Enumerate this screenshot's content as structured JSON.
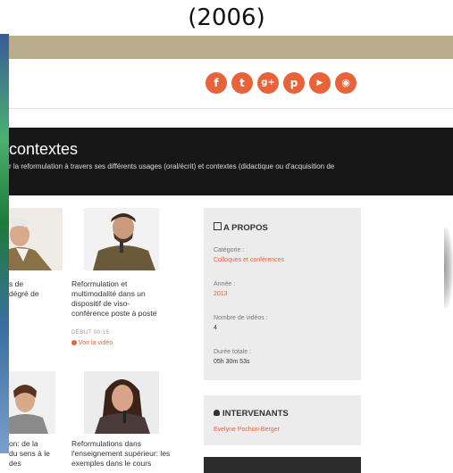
{
  "caption": "(2006)",
  "social": {
    "items": [
      {
        "icon": "facebook-icon",
        "glyph": "f"
      },
      {
        "icon": "twitter-icon",
        "glyph": "t"
      },
      {
        "icon": "google-plus-icon",
        "glyph": "g+"
      },
      {
        "icon": "pinterest-icon",
        "glyph": "p"
      },
      {
        "icon": "youtube-icon",
        "glyph": "▶"
      },
      {
        "icon": "rss-icon",
        "glyph": "◉"
      }
    ],
    "color": "#e8623a"
  },
  "header": {
    "title": "contextes",
    "subtitle": "r la reformulation à travers ses différents usages (oral/écrit) et contextes (didactique ou d'acquisition de"
  },
  "cards": [
    {
      "title_lines": [
        "s de",
        "dégré de"
      ]
    },
    {
      "title_lines": [
        "Reformulation et",
        "multimodalité dans un",
        "dispositif de viso-",
        "conférence poste à poste"
      ],
      "meta": "DÉBUT 00:15",
      "see": "Voir la vidéo"
    },
    {
      "title_lines": [
        "on: de la",
        "du sens à le",
        "des"
      ]
    },
    {
      "title_lines": [
        "Reformulations dans",
        "l'enseignement supérieur: les",
        "exemples dans le cours"
      ]
    }
  ],
  "about": {
    "heading": "A PROPOS",
    "category_label": "Catégorie :",
    "category_value": "Colloques et conférences",
    "year_label": "Année :",
    "year_value": "2013",
    "videos_label": "Nombre de vidéos :",
    "videos_value": "4",
    "duration_label": "Durée totale :",
    "duration_value": "05h 30m 53s"
  },
  "speakers": {
    "heading": "INTERVENANTS",
    "name": "Evelyne Pochon-Berger"
  },
  "colors": {
    "accent": "#e8623a",
    "band": "#171717",
    "topband": "#b9ad8d",
    "panel": "#ececec"
  }
}
